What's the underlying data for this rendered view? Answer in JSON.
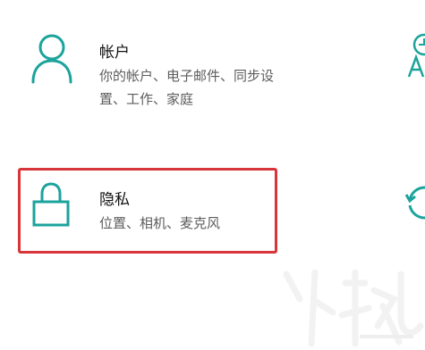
{
  "settings": {
    "accent_color": "#1ba39c",
    "highlight_color": "#d8353a",
    "accounts": {
      "title": "帐户",
      "description": "你的帐户、电子邮件、同步设置、工作、家庭",
      "icon": "person-icon"
    },
    "privacy": {
      "title": "隐私",
      "description": "位置、相机、麦克风",
      "icon": "lock-icon"
    },
    "time_language": {
      "icon": "clock-language-icon"
    },
    "update_security": {
      "icon": "sync-icon"
    }
  },
  "watermark": {
    "brand": "xiazaiba"
  }
}
